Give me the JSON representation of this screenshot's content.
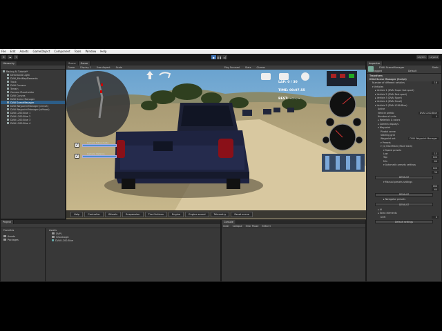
{
  "menu": [
    "File",
    "Edit",
    "Assets",
    "GameObject",
    "Component",
    "Tools",
    "Window",
    "Help"
  ],
  "toolbar": {
    "account": "Layers",
    "layout": "Layout",
    "left_buttons": [
      "⊕",
      "☁",
      "▾"
    ]
  },
  "hierarchy": {
    "tab": "Hierarchy",
    "rows": [
      {
        "label": "Racing AI Tutorial*",
        "indent": 0,
        "selected": false
      },
      {
        "label": "Directional Light",
        "indent": 1,
        "selected": false
      },
      {
        "label": "DVAI_MiniMapElements",
        "indent": 1,
        "selected": false
      },
      {
        "label": "Track",
        "indent": 1,
        "selected": false
      },
      {
        "label": "DVAI Camera",
        "indent": 1,
        "selected": false
      },
      {
        "label": "Terrain",
        "indent": 1,
        "selected": false
      },
      {
        "label": "Camera Placeholder",
        "indent": 1,
        "selected": false
      },
      {
        "label": "DVAI Canvas",
        "indent": 1,
        "selected": false
      },
      {
        "label": "DVAI Scene Manager",
        "indent": 1,
        "selected": false
      },
      {
        "label": "DVAI SceneManager",
        "indent": 1,
        "selected": true
      },
      {
        "label": "DVAI Waypoint Manager (circuit)",
        "indent": 1,
        "selected": false
      },
      {
        "label": "DVAI Waypoint Manager (offroad)",
        "indent": 1,
        "selected": false
      },
      {
        "label": "DVAI L200-Blue 1",
        "indent": 1,
        "selected": false
      },
      {
        "label": "DVAI L200-Blue 2",
        "indent": 1,
        "selected": false
      },
      {
        "label": "DVAI L200-Blue 3",
        "indent": 1,
        "selected": false
      },
      {
        "label": "DVAI L200-Blue 4",
        "indent": 1,
        "selected": false
      }
    ]
  },
  "game": {
    "tabs": [
      "Scene",
      "Game"
    ],
    "bar": [
      "Game",
      "Display 1",
      "Free Aspect",
      "Scale",
      "Play Focused",
      "Stats",
      "Gizmos"
    ],
    "lap": "LAP: 0 / 30",
    "time": "TIME: 00:07.55",
    "best": "BEST: --:--.--",
    "toggle1": "Camera follow mode",
    "toggle2": "Camera distance",
    "buttons": [
      "Help",
      "Controller",
      "Wheels",
      "Suspension",
      "Tire frictions",
      "Engine",
      "Engine sound",
      "Telemetry",
      "Reset scene"
    ]
  },
  "inspector": {
    "tab": "Inspector",
    "object_name": "DVAI SceneManager",
    "tag": "Untagged",
    "layer": "Default",
    "static": "Static",
    "rows": [
      {
        "label": "Transform",
        "cls": "cmp-hdr",
        "indent": 0
      },
      {
        "label": "DVAI Scene Manager (Script)",
        "cls": "cmp-hdr",
        "indent": 0
      },
      {
        "label": "Number of different vehicles",
        "cls": "",
        "indent": 1,
        "value": "16"
      },
      {
        "label": "▾ Vehicles",
        "cls": "",
        "indent": 1
      },
      {
        "label": "▸ Vehicle 1 (DVAI Super fast sport)",
        "cls": "",
        "indent": 2
      },
      {
        "label": "▸ Vehicle 2 (DVAI Fast sport)",
        "cls": "",
        "indent": 2
      },
      {
        "label": "▸ Vehicle 3 (DVAI Sport)",
        "cls": "",
        "indent": 2
      },
      {
        "label": "▸ Vehicle 4 (DVAI Small)",
        "cls": "",
        "indent": 2
      },
      {
        "label": "▾ Vehicle 5 (DVAI L200-Blue)",
        "cls": "",
        "indent": 2
      },
      {
        "label": "Active",
        "cls": "",
        "indent": 3
      },
      {
        "label": "Vehicle prefab",
        "cls": "",
        "indent": 3,
        "value": "DVAI L200-Blue"
      },
      {
        "label": "Number of units",
        "cls": "",
        "indent": 3,
        "value": "4"
      },
      {
        "label": "▸ Materials & colors",
        "cls": "",
        "indent": 3
      },
      {
        "label": "▸ Camera displays",
        "cls": "",
        "indent": 3
      },
      {
        "label": "▾ Waypoint",
        "cls": "",
        "indent": 3
      },
      {
        "label": "Pivotal scene",
        "cls": "",
        "indent": 4
      },
      {
        "label": "Starting grid",
        "cls": "",
        "indent": 4
      },
      {
        "label": "Waypoint set",
        "cls": "",
        "indent": 4,
        "value": "DVAI Waypoint Manager"
      },
      {
        "label": "▾ Presets",
        "cls": "",
        "indent": 4
      },
      {
        "label": "▾ (1) RaceTrack (Race track)",
        "cls": "",
        "indent": 4
      },
      {
        "label": "▾ Speed presets",
        "cls": "",
        "indent": 5
      },
      {
        "label": "Low",
        "cls": "",
        "indent": 5,
        "value": "15"
      },
      {
        "label": "Top",
        "cls": "",
        "indent": 5,
        "value": "100"
      },
      {
        "label": "Min",
        "cls": "",
        "indent": 5,
        "value": "60"
      },
      {
        "label": "▾ Automatic presets settings",
        "cls": "",
        "indent": 5
      },
      {
        "label": "",
        "cls": "",
        "indent": 5,
        "value": "100"
      },
      {
        "label": "",
        "cls": "",
        "indent": 5,
        "value": "30"
      },
      {
        "label": "DEFAULT",
        "cls": "btn",
        "indent": 0
      },
      {
        "label": "▾ Manual presets settings",
        "cls": "",
        "indent": 5
      },
      {
        "label": "",
        "cls": "",
        "indent": 5,
        "value": "160"
      },
      {
        "label": "",
        "cls": "",
        "indent": 5,
        "value": "60"
      },
      {
        "label": "DEFAULT",
        "cls": "btn",
        "indent": 0
      },
      {
        "label": "▸ Navigator presets",
        "cls": "",
        "indent": 5
      },
      {
        "label": "DEFAULT",
        "cls": "btn",
        "indent": 0
      },
      {
        "label": "▸ AI",
        "cls": "",
        "indent": 3
      },
      {
        "label": "▸ Extra elements",
        "cls": "",
        "indent": 3
      },
      {
        "label": "Drift",
        "cls": "",
        "indent": 4,
        "value": "0"
      },
      {
        "label": "Default settings",
        "cls": "btn",
        "indent": 0
      }
    ]
  },
  "project": {
    "tab": "Project",
    "favorites": "Favorites",
    "left": [
      "Assets",
      "Packages"
    ],
    "path": "Assets",
    "items": [
      "DVPL",
      "GhostLogic",
      "DVAI L200-Blue"
    ]
  },
  "console": {
    "tab": "Console",
    "bar": [
      "Clear",
      "Collapse",
      "Error Pause",
      "Editor ▾"
    ]
  },
  "colors": {
    "accent": "#2c5d87",
    "play": "#3c6fb0",
    "slider": "#4a8ecf",
    "truck": "#1e2340"
  }
}
